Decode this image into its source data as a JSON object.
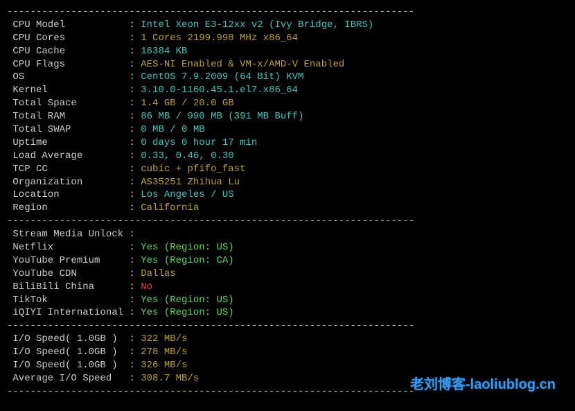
{
  "dash": "----------------------------------------------------------------------",
  "section1": [
    {
      "label": "CPU Model           ",
      "value": "Intel Xeon E3-12xx v2 (Ivy Bridge, IBRS)",
      "color": "cyan"
    },
    {
      "label": "CPU Cores           ",
      "value": "1 Cores 2199.998 MHz x86_64",
      "color": "olive"
    },
    {
      "label": "CPU Cache           ",
      "value": "16384 KB",
      "color": "cyan"
    },
    {
      "label": "CPU Flags           ",
      "value": "AES-NI Enabled & VM-x/AMD-V Enabled",
      "color": "olive"
    },
    {
      "label": "OS                  ",
      "value": "CentOS 7.9.2009 (64 Bit) KVM",
      "color": "cyan"
    },
    {
      "label": "Kernel              ",
      "value": "3.10.0-1160.45.1.el7.x86_64",
      "color": "cyan"
    },
    {
      "label": "Total Space         ",
      "value": "1.4 GB / 20.0 GB",
      "color": "olive"
    },
    {
      "label": "Total RAM           ",
      "value": "86 MB / 990 MB (391 MB Buff)",
      "color": "cyan"
    },
    {
      "label": "Total SWAP          ",
      "value": "0 MB / 0 MB",
      "color": "cyan"
    },
    {
      "label": "Uptime              ",
      "value": "0 days 0 hour 17 min",
      "color": "cyan"
    },
    {
      "label": "Load Average        ",
      "value": "0.33, 0.46, 0.30",
      "color": "cyan"
    },
    {
      "label": "TCP CC              ",
      "value": "cubic + pfifo_fast",
      "color": "olive"
    },
    {
      "label": "Organization        ",
      "value": "AS35251 Zhihua Lu",
      "color": "olive"
    },
    {
      "label": "Location            ",
      "value": "Los Angeles / US",
      "color": "cyan"
    },
    {
      "label": "Region              ",
      "value": "California",
      "color": "olive"
    }
  ],
  "section2_header": {
    "label": "Stream Media Unlock ",
    "value": "",
    "color": "white"
  },
  "section2": [
    {
      "label": "Netflix             ",
      "value": "Yes (Region: US)",
      "color": "lime"
    },
    {
      "label": "YouTube Premium     ",
      "value": "Yes (Region: CA)",
      "color": "lime"
    },
    {
      "label": "YouTube CDN         ",
      "value": "Dallas",
      "color": "olive"
    },
    {
      "label": "BiliBili China      ",
      "value": "No",
      "color": "red"
    },
    {
      "label": "TikTok              ",
      "value": "Yes (Region: US)",
      "color": "lime"
    },
    {
      "label": "iQIYI International ",
      "value": "Yes (Region: US)",
      "color": "lime"
    }
  ],
  "section3": [
    {
      "label": "I/O Speed( 1.0GB )  ",
      "value": "322 MB/s",
      "color": "olive"
    },
    {
      "label": "I/O Speed( 1.0GB )  ",
      "value": "278 MB/s",
      "color": "olive"
    },
    {
      "label": "I/O Speed( 1.0GB )  ",
      "value": "326 MB/s",
      "color": "olive"
    },
    {
      "label": "Average I/O Speed   ",
      "value": "308.7 MB/s",
      "color": "olive"
    }
  ],
  "watermark": "老刘博客-laoliublog.cn"
}
